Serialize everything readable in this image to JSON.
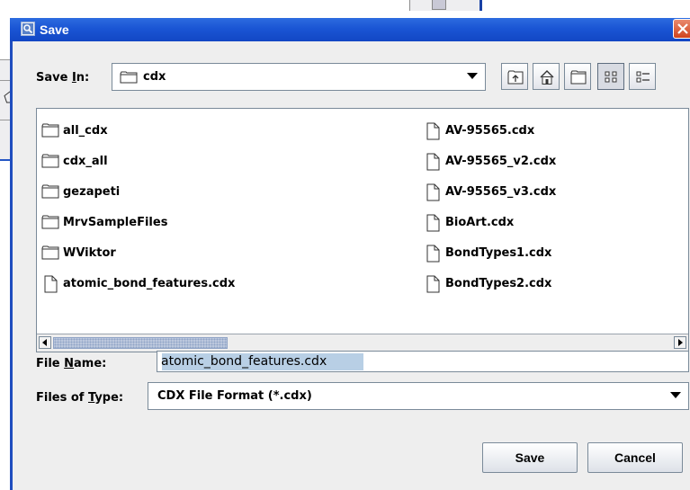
{
  "dialog": {
    "title": "Save",
    "save_in": {
      "label_pre": "Save ",
      "label_mnemonic": "I",
      "label_post": "n:",
      "folder_name": "cdx"
    },
    "toolbar": {
      "up_one_level": "up-folder-icon",
      "home": "home-icon",
      "new_folder": "new-folder-icon",
      "list_view": "list-view-icon",
      "details_view": "details-view-icon"
    },
    "files": {
      "left": [
        {
          "name": "all_cdx",
          "type": "folder"
        },
        {
          "name": "cdx_all",
          "type": "folder"
        },
        {
          "name": "gezapeti",
          "type": "folder"
        },
        {
          "name": "MrvSampleFiles",
          "type": "folder"
        },
        {
          "name": "WViktor",
          "type": "folder"
        },
        {
          "name": "atomic_bond_features.cdx",
          "type": "file"
        }
      ],
      "right": [
        {
          "name": "AV-95565.cdx",
          "type": "file"
        },
        {
          "name": "AV-95565_v2.cdx",
          "type": "file"
        },
        {
          "name": "AV-95565_v3.cdx",
          "type": "file"
        },
        {
          "name": "BioArt.cdx",
          "type": "file"
        },
        {
          "name": "BondTypes1.cdx",
          "type": "file"
        },
        {
          "name": "BondTypes2.cdx",
          "type": "file"
        }
      ]
    },
    "file_name": {
      "label_pre": "File ",
      "label_mnemonic": "N",
      "label_post": "ame:",
      "value": "atomic_bond_features.cdx"
    },
    "files_of_type": {
      "label_pre": "Files of ",
      "label_mnemonic": "T",
      "label_post": "ype:",
      "value": "CDX File Format (*.cdx)"
    },
    "buttons": {
      "save": "Save",
      "cancel": "Cancel"
    }
  }
}
